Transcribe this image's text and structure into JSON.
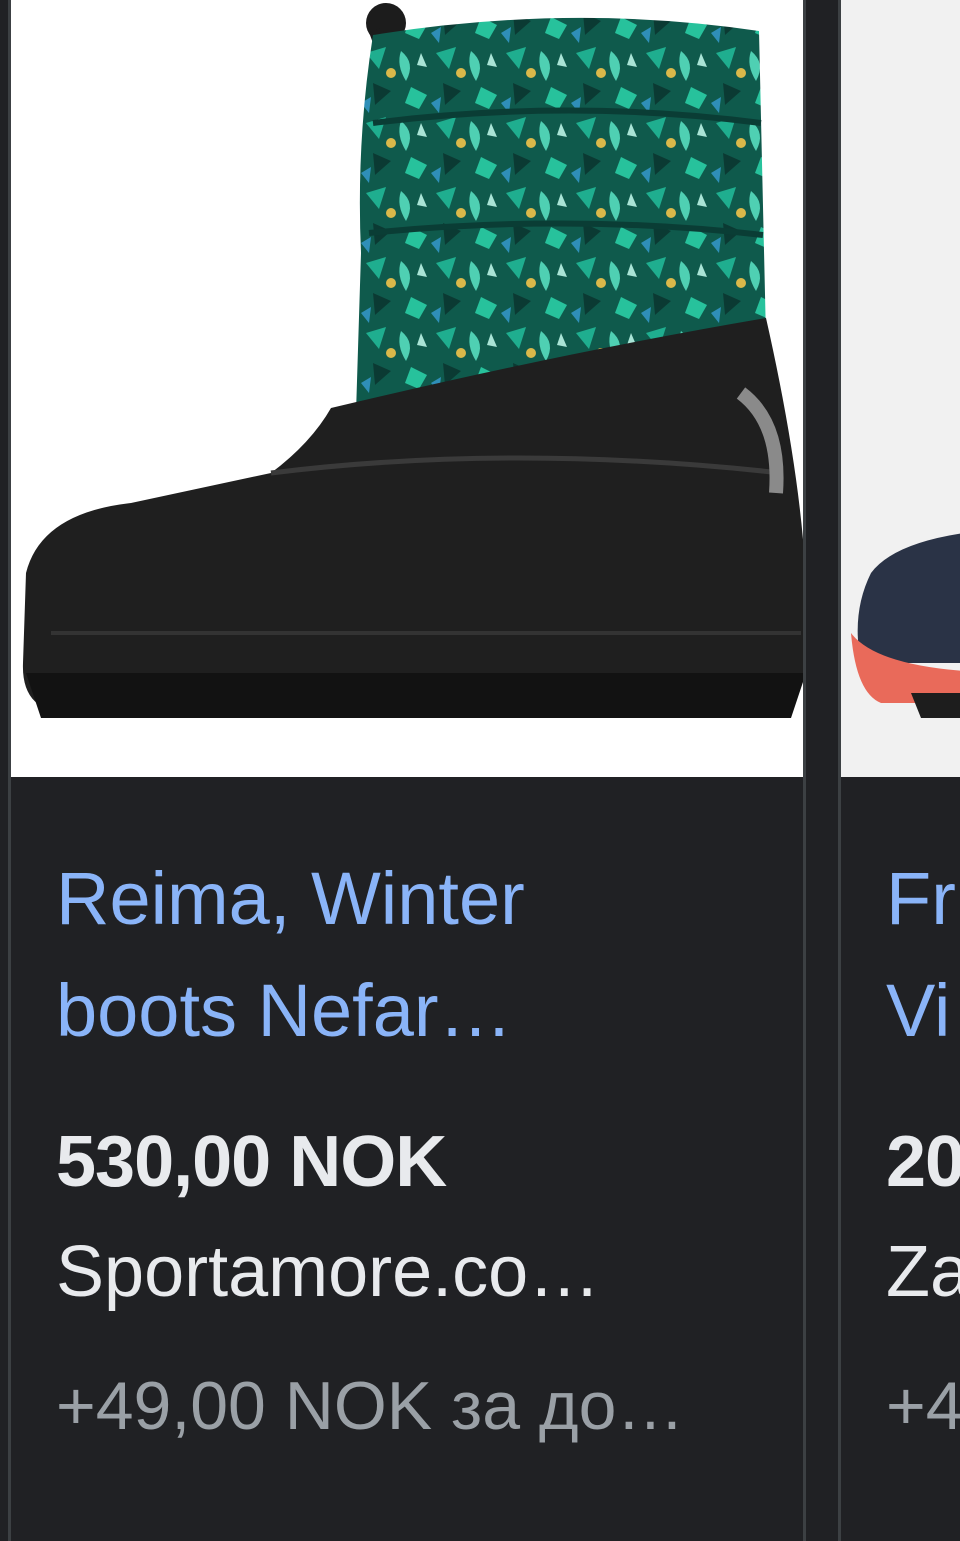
{
  "cards": [
    {
      "title": "Reima, Winter\nboots Nefar…",
      "price": "530,00 NOK",
      "store": "Sportamore.co…",
      "shipping": "+49,00 NOK за до…",
      "image_icon": "winter-boot-icon"
    },
    {
      "title": "Fr\nVi",
      "price": "20",
      "store": "Za",
      "shipping": "+4",
      "image_icon": "rubber-boot-icon"
    }
  ],
  "colors": {
    "background": "#202124",
    "title_link": "#8ab4f8",
    "price_text": "#e8eaed",
    "shipping_text": "#9aa0a6",
    "card_border": "#3c4043"
  }
}
